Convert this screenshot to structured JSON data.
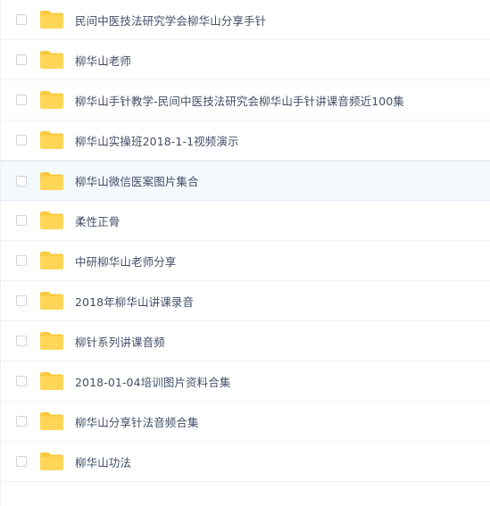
{
  "colors": {
    "folder_body": "#FFD658",
    "folder_tab": "#F9C93D",
    "text": "#424e67",
    "hover_background": "#f4f9fe"
  },
  "icon": "folder-icon",
  "hovered_index": 4,
  "items": [
    {
      "name": "民间中医技法研究学会柳华山分享手针"
    },
    {
      "name": "柳华山老师"
    },
    {
      "name": "柳华山手针教学-民间中医技法研究会柳华山手针讲课音频近100集"
    },
    {
      "name": "柳华山实操班2018-1-1视频演示"
    },
    {
      "name": "柳华山微信医案图片集合"
    },
    {
      "name": "柔性正骨"
    },
    {
      "name": "中研柳华山老师分享"
    },
    {
      "name": "2018年柳华山讲课录音"
    },
    {
      "name": "柳针系列讲课音频"
    },
    {
      "name": "2018-01-04培训图片资料合集"
    },
    {
      "name": "柳华山分享针法音频合集"
    },
    {
      "name": "柳华山功法"
    }
  ]
}
